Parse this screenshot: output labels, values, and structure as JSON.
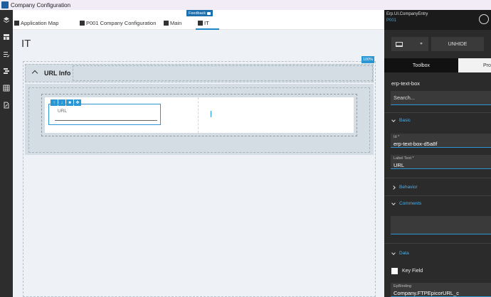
{
  "window": {
    "title": "Company Configuration"
  },
  "tabs": [
    {
      "label": "Application Map"
    },
    {
      "label": "P001 Company Configuration"
    },
    {
      "label": "Main"
    },
    {
      "label": "IT"
    }
  ],
  "feedback": {
    "label": "Feedback"
  },
  "canvas": {
    "page_title": "IT",
    "zoom": "100%",
    "panel_title": "URL Info",
    "field_label": "URL"
  },
  "right_panel": {
    "entry_name": "Erp.UI.CompanyEntry",
    "company": "P001",
    "unhide_label": "UNHIDE",
    "tabs": [
      "Toolbox",
      "Pro"
    ],
    "component_name": "erp-text-box",
    "search_placeholder": "Search...",
    "sections": {
      "basic": "Basic",
      "behavior": "Behavior",
      "comments": "Comments",
      "data": "Data"
    },
    "props": {
      "id_label": "Id *",
      "id_value": "erp-text-box-d5a8f",
      "label_text_label": "Label Text *",
      "label_text_value": "URL",
      "key_field_label": "Key Field",
      "epbinding_label": "EpBinding",
      "epbinding_value": "Company.FTPEpicorURL_c"
    }
  }
}
